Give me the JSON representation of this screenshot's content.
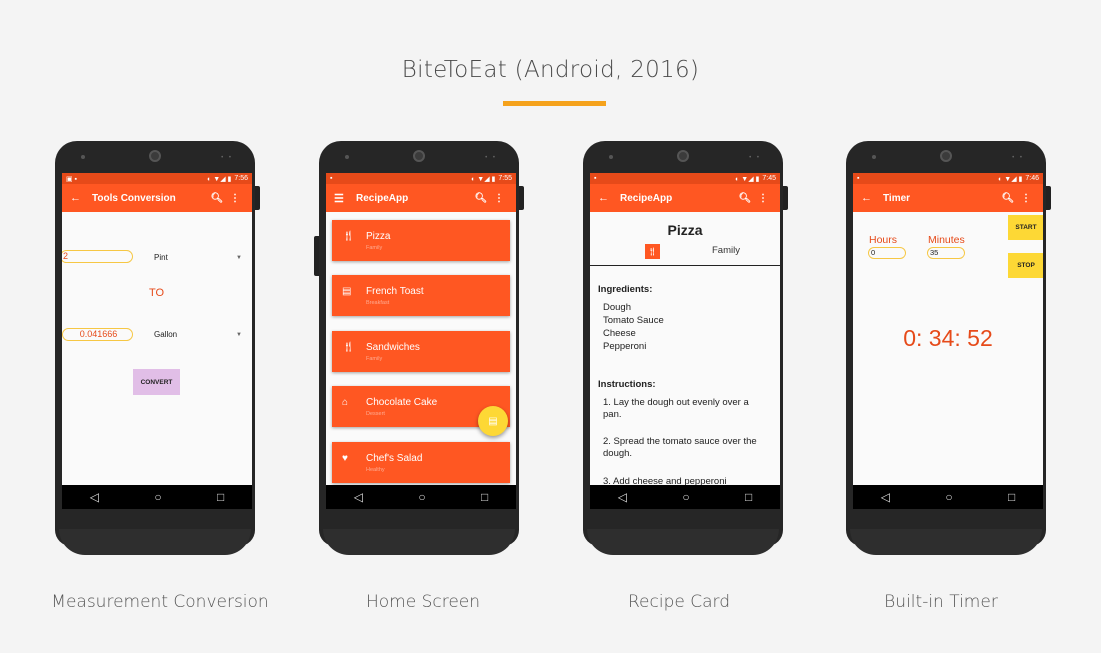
{
  "title": "BiteToEat (Android, 2016)",
  "accent_color": "#f5a21c",
  "brand_color": "#ff5722",
  "captions": [
    "Measurement Conversion",
    "Home Screen",
    "Recipe Card",
    "Built-in Timer"
  ],
  "phones": {
    "conversion": {
      "time": "7:56",
      "app_title": "Tools Conversion",
      "from_value": "2",
      "from_unit": "Pint",
      "to_label": "TO",
      "to_value": "0.041666",
      "to_unit": "Gallon",
      "convert_label": "CONVERT"
    },
    "home": {
      "time": "7:55",
      "app_title": "RecipeApp",
      "recipes": [
        {
          "name": "Pizza",
          "category": "Family",
          "icon": "fork-knife-icon"
        },
        {
          "name": "French Toast",
          "category": "Breakfast",
          "icon": "bread-icon"
        },
        {
          "name": "Sandwiches",
          "category": "Family",
          "icon": "fork-knife-icon"
        },
        {
          "name": "Chocolate Cake",
          "category": "Dessert",
          "icon": "cake-icon"
        },
        {
          "name": "Chef's Salad",
          "category": "Healthy",
          "icon": "heart-icon"
        }
      ]
    },
    "recipe": {
      "time": "7:45",
      "app_title": "RecipeApp",
      "name": "Pizza",
      "category": "Family",
      "ingredients_heading": "Ingredients:",
      "ingredients": [
        "Dough",
        "Tomato Sauce",
        "Cheese",
        "Pepperoni"
      ],
      "instructions_heading": "Instructions:",
      "steps": [
        "1. Lay the dough out evenly over a pan.",
        "2. Spread the tomato sauce over the dough.",
        "3. Add cheese and pepperoni"
      ]
    },
    "timer": {
      "time": "7:46",
      "app_title": "Timer",
      "hours_label": "Hours",
      "minutes_label": "Minutes",
      "hours_value": "0",
      "minutes_value": "35",
      "start_label": "START",
      "stop_label": "STOP",
      "clock": "0: 34: 52"
    }
  }
}
